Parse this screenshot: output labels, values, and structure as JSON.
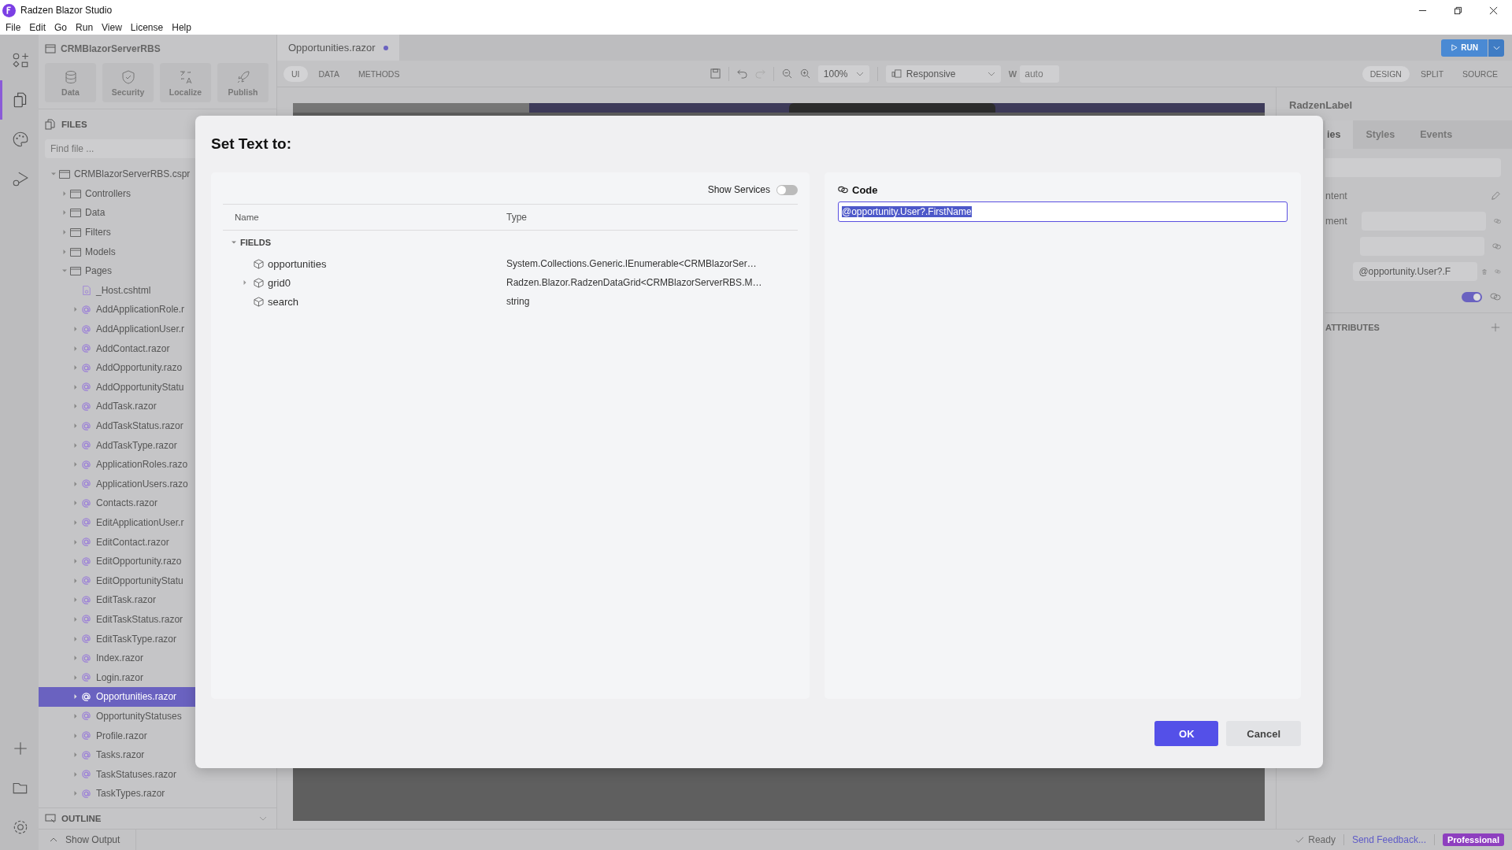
{
  "window": {
    "title": "Radzen Blazor Studio"
  },
  "menu": [
    "File",
    "Edit",
    "Go",
    "Run",
    "View",
    "License",
    "Help"
  ],
  "activity_bar": [
    {
      "kind": "components",
      "selected": false
    },
    {
      "kind": "files",
      "selected": true
    },
    {
      "kind": "themes",
      "selected": false
    },
    {
      "kind": "debug",
      "selected": false
    }
  ],
  "activity_bar_bottom": [
    {
      "kind": "add"
    },
    {
      "kind": "open"
    },
    {
      "kind": "settings"
    }
  ],
  "project": {
    "name": "CRMBlazorServerRBS",
    "tools": [
      {
        "label": "Data",
        "kind": "database"
      },
      {
        "label": "Security",
        "kind": "shield"
      },
      {
        "label": "Localize",
        "kind": "translate"
      },
      {
        "label": "Publish",
        "kind": "rocket"
      }
    ]
  },
  "files": {
    "title": "FILES",
    "search": {
      "placeholder": "Find file ..."
    },
    "tree": [
      {
        "label": "CRMBlazorServerRBS.cspr",
        "kind": "project",
        "expanded": true,
        "selected": false,
        "children": [
          {
            "label": "Controllers",
            "kind": "folder",
            "expanded": false,
            "selected": false
          },
          {
            "label": "Data",
            "kind": "folder",
            "expanded": false,
            "selected": false
          },
          {
            "label": "Filters",
            "kind": "folder",
            "expanded": false,
            "selected": false
          },
          {
            "label": "Models",
            "kind": "folder",
            "expanded": false,
            "selected": false
          },
          {
            "label": "Pages",
            "kind": "folder",
            "expanded": true,
            "selected": false,
            "children": [
              {
                "label": "_Host.cshtml",
                "kind": "cshtml",
                "selected": false
              },
              {
                "label": "AddApplicationRole.r",
                "kind": "razor",
                "expanded": false,
                "selected": false
              },
              {
                "label": "AddApplicationUser.r",
                "kind": "razor",
                "expanded": false,
                "selected": false
              },
              {
                "label": "AddContact.razor",
                "kind": "razor",
                "expanded": false,
                "selected": false
              },
              {
                "label": "AddOpportunity.razo",
                "kind": "razor",
                "expanded": false,
                "selected": false
              },
              {
                "label": "AddOpportunityStatu",
                "kind": "razor",
                "expanded": false,
                "selected": false
              },
              {
                "label": "AddTask.razor",
                "kind": "razor",
                "expanded": false,
                "selected": false
              },
              {
                "label": "AddTaskStatus.razor",
                "kind": "razor",
                "expanded": false,
                "selected": false
              },
              {
                "label": "AddTaskType.razor",
                "kind": "razor",
                "expanded": false,
                "selected": false
              },
              {
                "label": "ApplicationRoles.razo",
                "kind": "razor",
                "expanded": false,
                "selected": false
              },
              {
                "label": "ApplicationUsers.razo",
                "kind": "razor",
                "expanded": false,
                "selected": false
              },
              {
                "label": "Contacts.razor",
                "kind": "razor",
                "expanded": false,
                "selected": false
              },
              {
                "label": "EditApplicationUser.r",
                "kind": "razor",
                "expanded": false,
                "selected": false
              },
              {
                "label": "EditContact.razor",
                "kind": "razor",
                "expanded": false,
                "selected": false
              },
              {
                "label": "EditOpportunity.razo",
                "kind": "razor",
                "expanded": false,
                "selected": false
              },
              {
                "label": "EditOpportunityStatu",
                "kind": "razor",
                "expanded": false,
                "selected": false
              },
              {
                "label": "EditTask.razor",
                "kind": "razor",
                "expanded": false,
                "selected": false
              },
              {
                "label": "EditTaskStatus.razor",
                "kind": "razor",
                "expanded": false,
                "selected": false
              },
              {
                "label": "EditTaskType.razor",
                "kind": "razor",
                "expanded": false,
                "selected": false
              },
              {
                "label": "Index.razor",
                "kind": "razor",
                "expanded": false,
                "selected": false
              },
              {
                "label": "Login.razor",
                "kind": "razor",
                "expanded": false,
                "selected": false
              },
              {
                "label": "Opportunities.razor",
                "kind": "razor",
                "expanded": false,
                "selected": true
              },
              {
                "label": "OpportunityStatuses",
                "kind": "razor",
                "expanded": false,
                "selected": false
              },
              {
                "label": "Profile.razor",
                "kind": "razor",
                "expanded": false,
                "selected": false
              },
              {
                "label": "Tasks.razor",
                "kind": "razor",
                "expanded": false,
                "selected": false
              },
              {
                "label": "TaskStatuses.razor",
                "kind": "razor",
                "expanded": false,
                "selected": false
              },
              {
                "label": "TaskTypes.razor",
                "kind": "razor",
                "expanded": false,
                "selected": false
              }
            ]
          }
        ]
      }
    ]
  },
  "outline": {
    "title": "OUTLINE",
    "expanded": false
  },
  "editor": {
    "tabs": [
      {
        "label": "Opportunities.razor",
        "modified": true,
        "selected": true
      }
    ],
    "modes": [
      {
        "label": "UI",
        "selected": true
      },
      {
        "label": "DATA",
        "selected": false
      },
      {
        "label": "METHODS",
        "selected": false
      }
    ],
    "zoom": "100%",
    "device": "Responsive",
    "width_label": "W",
    "width": "auto",
    "views": [
      {
        "label": "DESIGN",
        "selected": true
      },
      {
        "label": "SPLIT",
        "selected": false
      },
      {
        "label": "SOURCE",
        "selected": false
      }
    ],
    "run": "RUN"
  },
  "properties": {
    "component": "RadzenLabel",
    "tabs": [
      {
        "label": "ies",
        "selected": true
      },
      {
        "label": "Styles",
        "selected": false
      },
      {
        "label": "Events",
        "selected": false
      }
    ],
    "rows": [
      {
        "kind": "edit",
        "label": "ntent"
      },
      {
        "kind": "input",
        "label": "ment"
      },
      {
        "kind": "input"
      },
      {
        "kind": "input",
        "value": "@opportunity.User?.F",
        "removable": true
      },
      {
        "kind": "toggle",
        "on": true
      }
    ],
    "attributes": "ATTRIBUTES"
  },
  "dialog": {
    "title": "Set Text to:",
    "show_services": {
      "label": "Show Services",
      "on": false
    },
    "columns": [
      "Name",
      "Type"
    ],
    "groups": [
      {
        "label": "FIELDS",
        "expanded": true,
        "items": [
          {
            "name": "opportunities",
            "type": "System.Collections.Generic.IEnumerable<CRMBlazorSer…",
            "expandable": false,
            "selected": false
          },
          {
            "name": "grid0",
            "type": "Radzen.Blazor.RadzenDataGrid<CRMBlazorServerRBS.M…",
            "expandable": true,
            "selected": false
          },
          {
            "name": "search",
            "type": "string",
            "expandable": false,
            "selected": false
          }
        ]
      }
    ],
    "code": {
      "label": "Code",
      "value": "@opportunity.User?.FirstName",
      "selected": true
    },
    "buttons": [
      {
        "label": "OK",
        "kind": "primary"
      },
      {
        "label": "Cancel",
        "kind": "secondary"
      }
    ]
  },
  "status_bar": {
    "output": "Show Output",
    "status": "Ready",
    "feedback": "Send Feedback...",
    "edition": "Professional"
  }
}
